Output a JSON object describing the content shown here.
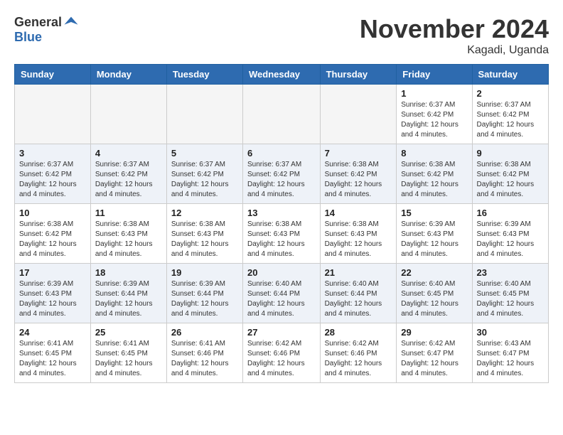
{
  "logo": {
    "general": "General",
    "blue": "Blue"
  },
  "title": "November 2024",
  "location": "Kagadi, Uganda",
  "days_of_week": [
    "Sunday",
    "Monday",
    "Tuesday",
    "Wednesday",
    "Thursday",
    "Friday",
    "Saturday"
  ],
  "weeks": [
    {
      "days": [
        {
          "date": "",
          "empty": true
        },
        {
          "date": "",
          "empty": true
        },
        {
          "date": "",
          "empty": true
        },
        {
          "date": "",
          "empty": true
        },
        {
          "date": "",
          "empty": true
        },
        {
          "date": "1",
          "sunrise": "Sunrise: 6:37 AM",
          "sunset": "Sunset: 6:42 PM",
          "daylight": "Daylight: 12 hours and 4 minutes."
        },
        {
          "date": "2",
          "sunrise": "Sunrise: 6:37 AM",
          "sunset": "Sunset: 6:42 PM",
          "daylight": "Daylight: 12 hours and 4 minutes."
        }
      ]
    },
    {
      "days": [
        {
          "date": "3",
          "sunrise": "Sunrise: 6:37 AM",
          "sunset": "Sunset: 6:42 PM",
          "daylight": "Daylight: 12 hours and 4 minutes."
        },
        {
          "date": "4",
          "sunrise": "Sunrise: 6:37 AM",
          "sunset": "Sunset: 6:42 PM",
          "daylight": "Daylight: 12 hours and 4 minutes."
        },
        {
          "date": "5",
          "sunrise": "Sunrise: 6:37 AM",
          "sunset": "Sunset: 6:42 PM",
          "daylight": "Daylight: 12 hours and 4 minutes."
        },
        {
          "date": "6",
          "sunrise": "Sunrise: 6:37 AM",
          "sunset": "Sunset: 6:42 PM",
          "daylight": "Daylight: 12 hours and 4 minutes."
        },
        {
          "date": "7",
          "sunrise": "Sunrise: 6:38 AM",
          "sunset": "Sunset: 6:42 PM",
          "daylight": "Daylight: 12 hours and 4 minutes."
        },
        {
          "date": "8",
          "sunrise": "Sunrise: 6:38 AM",
          "sunset": "Sunset: 6:42 PM",
          "daylight": "Daylight: 12 hours and 4 minutes."
        },
        {
          "date": "9",
          "sunrise": "Sunrise: 6:38 AM",
          "sunset": "Sunset: 6:42 PM",
          "daylight": "Daylight: 12 hours and 4 minutes."
        }
      ]
    },
    {
      "days": [
        {
          "date": "10",
          "sunrise": "Sunrise: 6:38 AM",
          "sunset": "Sunset: 6:42 PM",
          "daylight": "Daylight: 12 hours and 4 minutes."
        },
        {
          "date": "11",
          "sunrise": "Sunrise: 6:38 AM",
          "sunset": "Sunset: 6:43 PM",
          "daylight": "Daylight: 12 hours and 4 minutes."
        },
        {
          "date": "12",
          "sunrise": "Sunrise: 6:38 AM",
          "sunset": "Sunset: 6:43 PM",
          "daylight": "Daylight: 12 hours and 4 minutes."
        },
        {
          "date": "13",
          "sunrise": "Sunrise: 6:38 AM",
          "sunset": "Sunset: 6:43 PM",
          "daylight": "Daylight: 12 hours and 4 minutes."
        },
        {
          "date": "14",
          "sunrise": "Sunrise: 6:38 AM",
          "sunset": "Sunset: 6:43 PM",
          "daylight": "Daylight: 12 hours and 4 minutes."
        },
        {
          "date": "15",
          "sunrise": "Sunrise: 6:39 AM",
          "sunset": "Sunset: 6:43 PM",
          "daylight": "Daylight: 12 hours and 4 minutes."
        },
        {
          "date": "16",
          "sunrise": "Sunrise: 6:39 AM",
          "sunset": "Sunset: 6:43 PM",
          "daylight": "Daylight: 12 hours and 4 minutes."
        }
      ]
    },
    {
      "days": [
        {
          "date": "17",
          "sunrise": "Sunrise: 6:39 AM",
          "sunset": "Sunset: 6:43 PM",
          "daylight": "Daylight: 12 hours and 4 minutes."
        },
        {
          "date": "18",
          "sunrise": "Sunrise: 6:39 AM",
          "sunset": "Sunset: 6:44 PM",
          "daylight": "Daylight: 12 hours and 4 minutes."
        },
        {
          "date": "19",
          "sunrise": "Sunrise: 6:39 AM",
          "sunset": "Sunset: 6:44 PM",
          "daylight": "Daylight: 12 hours and 4 minutes."
        },
        {
          "date": "20",
          "sunrise": "Sunrise: 6:40 AM",
          "sunset": "Sunset: 6:44 PM",
          "daylight": "Daylight: 12 hours and 4 minutes."
        },
        {
          "date": "21",
          "sunrise": "Sunrise: 6:40 AM",
          "sunset": "Sunset: 6:44 PM",
          "daylight": "Daylight: 12 hours and 4 minutes."
        },
        {
          "date": "22",
          "sunrise": "Sunrise: 6:40 AM",
          "sunset": "Sunset: 6:45 PM",
          "daylight": "Daylight: 12 hours and 4 minutes."
        },
        {
          "date": "23",
          "sunrise": "Sunrise: 6:40 AM",
          "sunset": "Sunset: 6:45 PM",
          "daylight": "Daylight: 12 hours and 4 minutes."
        }
      ]
    },
    {
      "days": [
        {
          "date": "24",
          "sunrise": "Sunrise: 6:41 AM",
          "sunset": "Sunset: 6:45 PM",
          "daylight": "Daylight: 12 hours and 4 minutes."
        },
        {
          "date": "25",
          "sunrise": "Sunrise: 6:41 AM",
          "sunset": "Sunset: 6:45 PM",
          "daylight": "Daylight: 12 hours and 4 minutes."
        },
        {
          "date": "26",
          "sunrise": "Sunrise: 6:41 AM",
          "sunset": "Sunset: 6:46 PM",
          "daylight": "Daylight: 12 hours and 4 minutes."
        },
        {
          "date": "27",
          "sunrise": "Sunrise: 6:42 AM",
          "sunset": "Sunset: 6:46 PM",
          "daylight": "Daylight: 12 hours and 4 minutes."
        },
        {
          "date": "28",
          "sunrise": "Sunrise: 6:42 AM",
          "sunset": "Sunset: 6:46 PM",
          "daylight": "Daylight: 12 hours and 4 minutes."
        },
        {
          "date": "29",
          "sunrise": "Sunrise: 6:42 AM",
          "sunset": "Sunset: 6:47 PM",
          "daylight": "Daylight: 12 hours and 4 minutes."
        },
        {
          "date": "30",
          "sunrise": "Sunrise: 6:43 AM",
          "sunset": "Sunset: 6:47 PM",
          "daylight": "Daylight: 12 hours and 4 minutes."
        }
      ]
    }
  ]
}
